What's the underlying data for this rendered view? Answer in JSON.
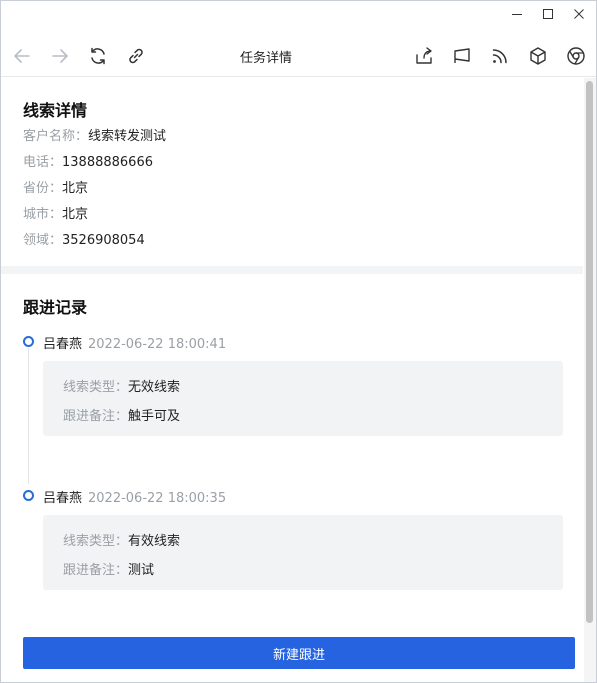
{
  "window": {
    "controls": {
      "minimize_icon": "minimize-icon",
      "maximize_icon": "maximize-icon",
      "close_icon": "close-icon"
    }
  },
  "toolbar": {
    "title": "任务详情",
    "icons_left": [
      "back-arrow-icon",
      "forward-arrow-icon",
      "refresh-icon",
      "link-icon"
    ],
    "icons_right": [
      "share-icon",
      "flag-icon",
      "rss-icon",
      "cube-icon",
      "chrome-icon"
    ]
  },
  "lead": {
    "title": "线索详情",
    "fields": [
      {
        "label": "客户名称：",
        "value": "线索转发测试"
      },
      {
        "label": "电话：",
        "value": "13888886666"
      },
      {
        "label": "省份：",
        "value": "北京"
      },
      {
        "label": "城市：",
        "value": "北京"
      },
      {
        "label": "领域：",
        "value": "3526908054"
      }
    ]
  },
  "followups": {
    "title": "跟进记录",
    "items": [
      {
        "name": "吕春燕",
        "time": "2022-06-22 18:00:41",
        "type_label": "线索类型：",
        "type_value": "无效线索",
        "note_label": "跟进备注：",
        "note_value": "触手可及"
      },
      {
        "name": "吕春燕",
        "time": "2022-06-22 18:00:35",
        "type_label": "线索类型：",
        "type_value": "有效线索",
        "note_label": "跟进备注：",
        "note_value": "测试"
      }
    ]
  },
  "actions": {
    "new_followup_label": "新建跟进"
  },
  "colors": {
    "primary": "#2563e0",
    "timeline_dot": "#2a6bd6",
    "muted_text": "#9aa0a6",
    "card_bg": "#f2f3f5"
  }
}
